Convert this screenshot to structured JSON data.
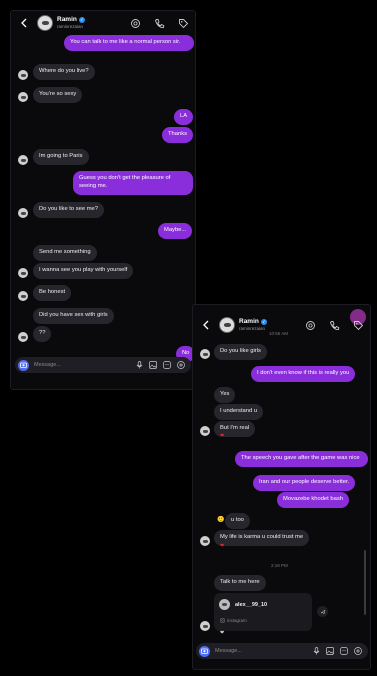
{
  "colors": {
    "incoming": "#26262c",
    "outgoing": "#8a2ddb",
    "accent": "#4f6ef5",
    "heart": "#e0253b"
  },
  "header": {
    "name": "Ramin",
    "username": "raminrezaian",
    "username2": "raminrezaian",
    "icons": [
      "back-icon",
      "video-call-icon",
      "phone-icon",
      "tag-icon"
    ]
  },
  "panel1": {
    "messages": [
      {
        "dir": "out",
        "text": "You can talk to me like a normal person sir."
      },
      {
        "dir": "in",
        "text": "Where do you live?"
      },
      {
        "dir": "in",
        "text": "You're so sexy"
      },
      {
        "dir": "out",
        "text": "LA"
      },
      {
        "dir": "out",
        "text": "Thanks"
      },
      {
        "dir": "in",
        "text": "Im going to Paris"
      },
      {
        "dir": "out",
        "text": "Guess you don't get the pleasure of seeing me."
      },
      {
        "dir": "in",
        "text": "Do you like to see me?"
      },
      {
        "dir": "out",
        "text": "Maybe..."
      },
      {
        "dir": "in",
        "text": "Send me something"
      },
      {
        "dir": "in",
        "text": "I wanna see you play with yourself"
      },
      {
        "dir": "in",
        "text": "Be honest"
      },
      {
        "dir": "in",
        "text": "Did you have sex with girls"
      },
      {
        "dir": "in",
        "text": "??"
      },
      {
        "dir": "out",
        "text": "No"
      }
    ],
    "composer_placeholder": "Message..."
  },
  "panel2": {
    "timestamp_top": "10:56 AM",
    "messages": [
      {
        "dir": "in",
        "text": "Do you like girls"
      },
      {
        "dir": "out",
        "text": "I don't even know if this is really you"
      },
      {
        "dir": "in",
        "text": "Yes"
      },
      {
        "dir": "in",
        "text": "I understand u"
      },
      {
        "dir": "in",
        "text": "But I'm real"
      },
      {
        "dir": "out",
        "text": "The speech you gave after the game was nice"
      },
      {
        "dir": "out",
        "text": "Iran and our people deserve better."
      },
      {
        "dir": "out",
        "text": "Movazebe khodet bash"
      },
      {
        "dir": "in",
        "text": "u too"
      },
      {
        "dir": "in",
        "text": "My life is karma u could trust me"
      },
      {
        "dir": "in",
        "text": "Talk to me here"
      }
    ],
    "hearts": [
      "❤",
      "❤",
      "❤"
    ],
    "reply_emoji": "🙂",
    "timestamp_mid": "2:18 PM",
    "shared_card": {
      "user": "alex__99_10",
      "source": "instagram"
    },
    "composer_placeholder": "Message..."
  }
}
